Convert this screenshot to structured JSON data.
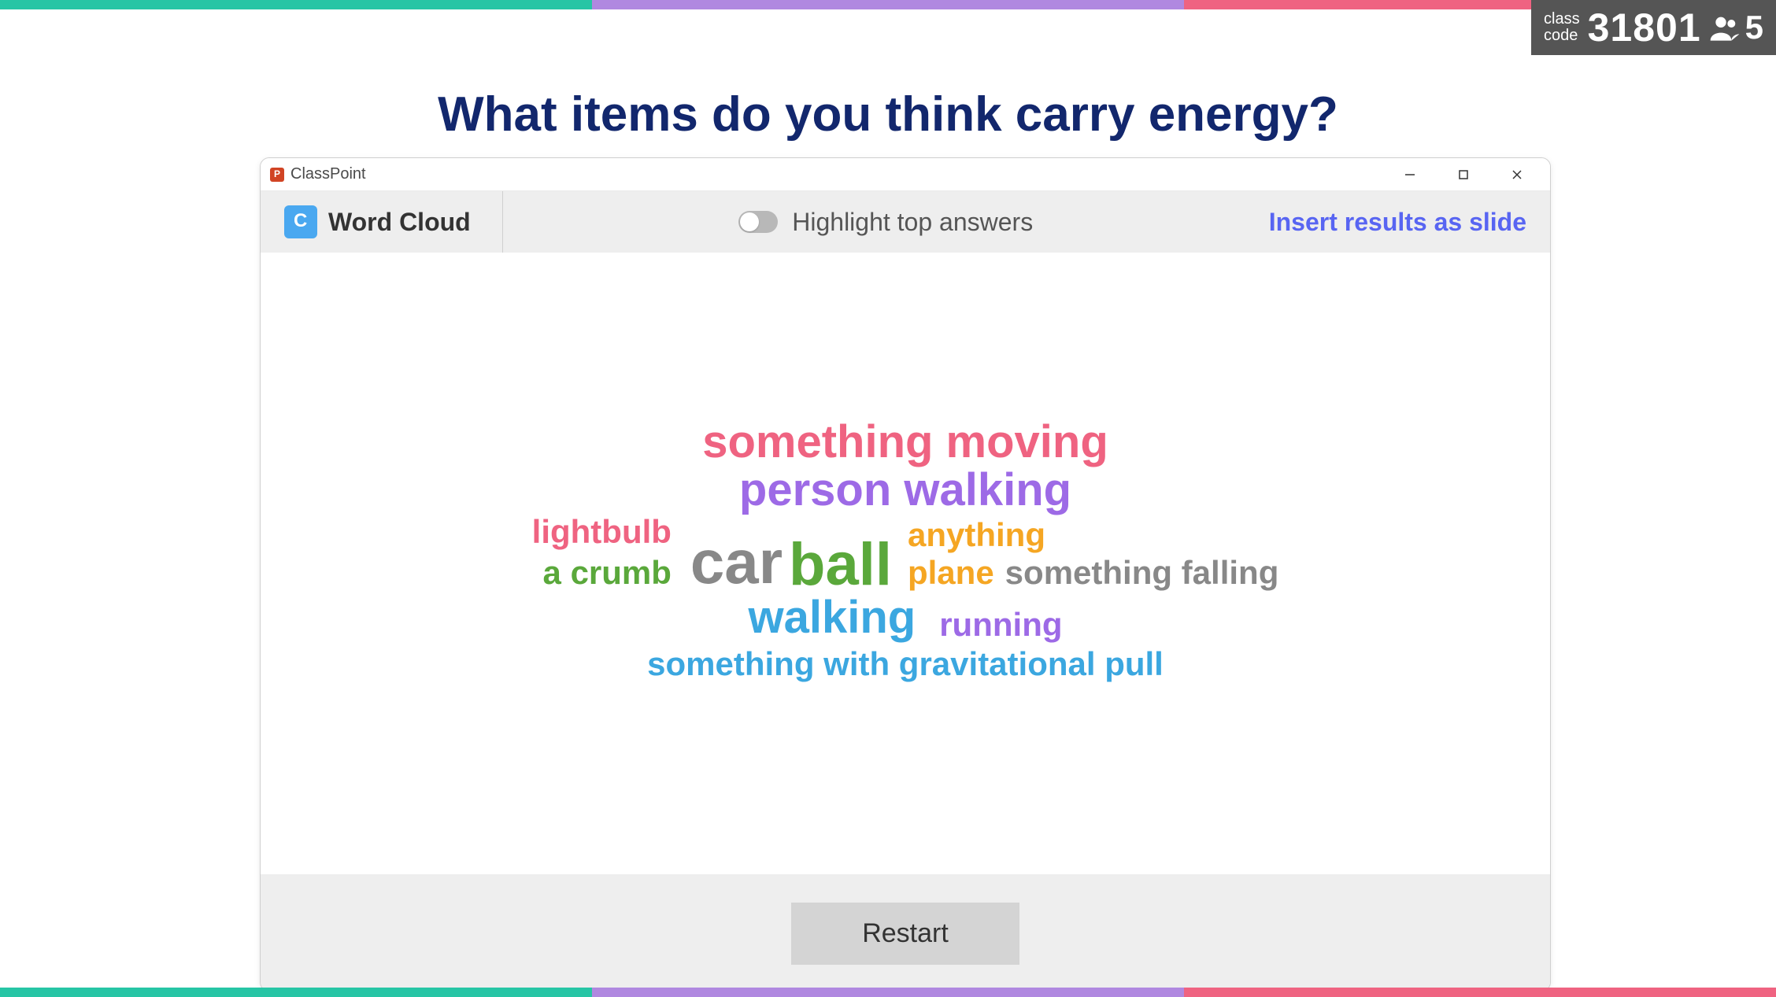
{
  "class_badge": {
    "label_line1": "class",
    "label_line2": "code",
    "code": "31801",
    "participants": "5"
  },
  "heading": "What items do you think carry energy?",
  "dialog": {
    "app_title": "ClassPoint",
    "feature_label": "Word Cloud",
    "highlight_label": "Highlight top answers",
    "insert_label": "Insert results as slide",
    "restart_label": "Restart"
  },
  "words": {
    "something_moving": "something moving",
    "person_walking": "person walking",
    "lightbulb": "lightbulb",
    "a_crumb": "a crumb",
    "car": "car",
    "ball": "ball",
    "anything": "anything",
    "plane": "plane",
    "something_falling": "something falling",
    "walking": "walking",
    "running": "running",
    "gravitational": "something with gravitational pull"
  }
}
